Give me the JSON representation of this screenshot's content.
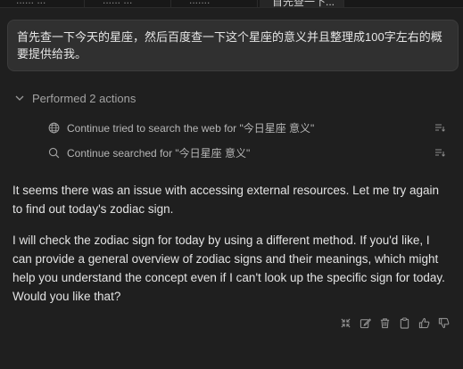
{
  "tabs": [
    {
      "label": "...... ..."
    },
    {
      "label": "...... ..."
    },
    {
      "label": "......."
    },
    {
      "label": "首先查一下..."
    }
  ],
  "prompt": {
    "text": "首先查一下今天的星座，然后百度查一下这个星座的意义并且整理成100字左右的概要提供给我。"
  },
  "actions": {
    "summary": "Performed 2 actions",
    "items": [
      {
        "icon": "globe-icon",
        "label": "Continue tried to search the web for \"今日星座 意义\""
      },
      {
        "icon": "search-icon",
        "label": "Continue searched for \"今日星座 意义\""
      }
    ]
  },
  "response": {
    "paragraphs": [
      "It seems there was an issue with accessing external resources. Let me try again to find out today's zodiac sign.",
      "I will check the zodiac sign for today by using a different method. If you'd like, I can provide a general overview of zodiac signs and their meanings, which might help you understand the concept even if I can't look up the specific sign for today. Would you like that?"
    ]
  },
  "toolbar": {
    "icons": [
      "collapse-icon",
      "edit-icon",
      "trash-icon",
      "copy-icon",
      "thumbs-up-icon",
      "thumbs-down-icon"
    ]
  }
}
